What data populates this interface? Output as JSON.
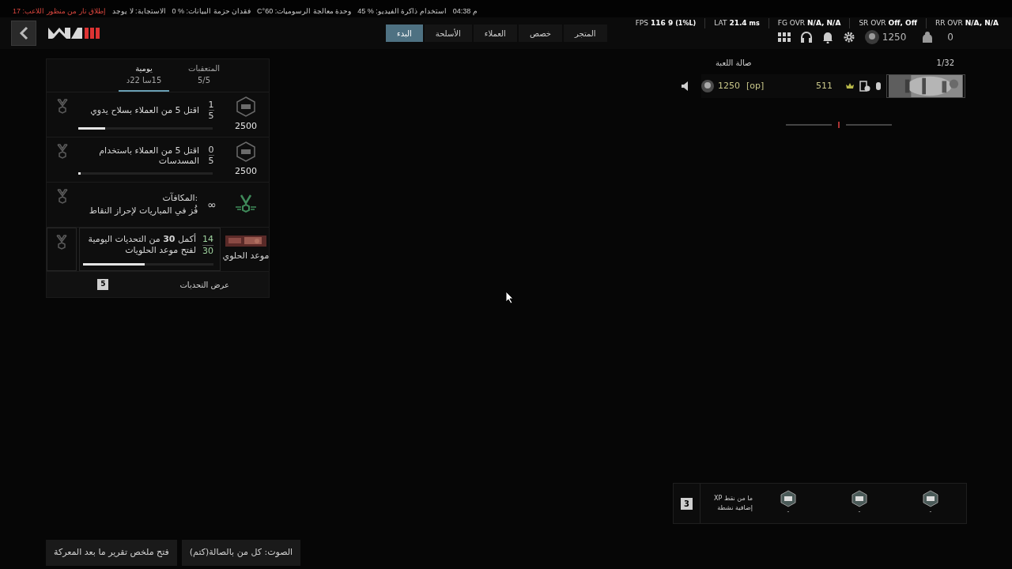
{
  "status_line": [
    {
      "text": "م 04:38",
      "alert": false
    },
    {
      "text": "استخدام ذاكرة الفيديو: % 45",
      "alert": false
    },
    {
      "text": "وحدة معالجة الرسوميات: 60°C",
      "alert": false
    },
    {
      "text": "فقدان حزمة البيانات: % 0",
      "alert": false
    },
    {
      "text": "الاستجابة: لا يوجد",
      "alert": false
    },
    {
      "text": "إطلاق نار من منظور اللاعب: 17",
      "alert": true
    }
  ],
  "perf_stats": [
    {
      "label": "RR OVR",
      "value": "N/A, N/A"
    },
    {
      "label": "SR OVR",
      "value": "Off, Off"
    },
    {
      "label": "FG OVR",
      "value": "N/A, N/A"
    },
    {
      "label": "LAT",
      "value": "21.4",
      "note": "ms"
    },
    {
      "label": "FPS",
      "value": "116 9",
      "note": "(1%L)"
    }
  ],
  "nav_tabs": [
    {
      "label": "المتجر",
      "selected": false
    },
    {
      "label": "خصص",
      "selected": false
    },
    {
      "label": "العملاء",
      "selected": false
    },
    {
      "label": "الأسلحة",
      "selected": false
    },
    {
      "label": "البدء",
      "selected": true
    }
  ],
  "toolbar": {
    "currency": "1250",
    "party_count": "0"
  },
  "challenges": {
    "tabs": [
      {
        "label": "المتعقبات",
        "sub": "5/5",
        "selected": false
      },
      {
        "label": "يومية",
        "sub": "15سا 22د",
        "selected": true
      }
    ],
    "rows": [
      {
        "kind": "challenge",
        "progress": "1",
        "total": "5",
        "text": "اقتل 5 من العملاء بسلاح يدوي",
        "reward": "2500",
        "level": 0.2
      },
      {
        "kind": "challenge",
        "progress": "0",
        "total": "5",
        "text": "اقتل 5 من العملاء باستخدام المسدسات",
        "reward": "2500",
        "level": 0.02
      },
      {
        "kind": "reward",
        "title": "المكافآت:",
        "text": "فُز في المباريات لإحراز النقاط",
        "symbol": "∞"
      },
      {
        "kind": "event",
        "progress": "14",
        "total": "30",
        "text": "أكمل **30** من التحديات اليومية لفتح موعد الحلويات",
        "event_name": "موعد الحلوي",
        "level": 0.47
      }
    ],
    "footer": {
      "label": "عرض التحديات",
      "count": "5"
    }
  },
  "lobby": {
    "title": "صالة اللعبة",
    "count": "1/32",
    "player": {
      "rank": "1250",
      "tag": "[op]",
      "name": "511"
    }
  },
  "xp_tokens": {
    "count": "3",
    "text": "ما من نقط XP إضافية نشطة",
    "tokens": [
      {
        "label": "-"
      },
      {
        "label": "-"
      },
      {
        "label": "-"
      }
    ]
  },
  "bottom_buttons": [
    "الصوت: كل من بالصالة(كتم)",
    "فتح ملخص تقرير ما بعد المعركة"
  ]
}
